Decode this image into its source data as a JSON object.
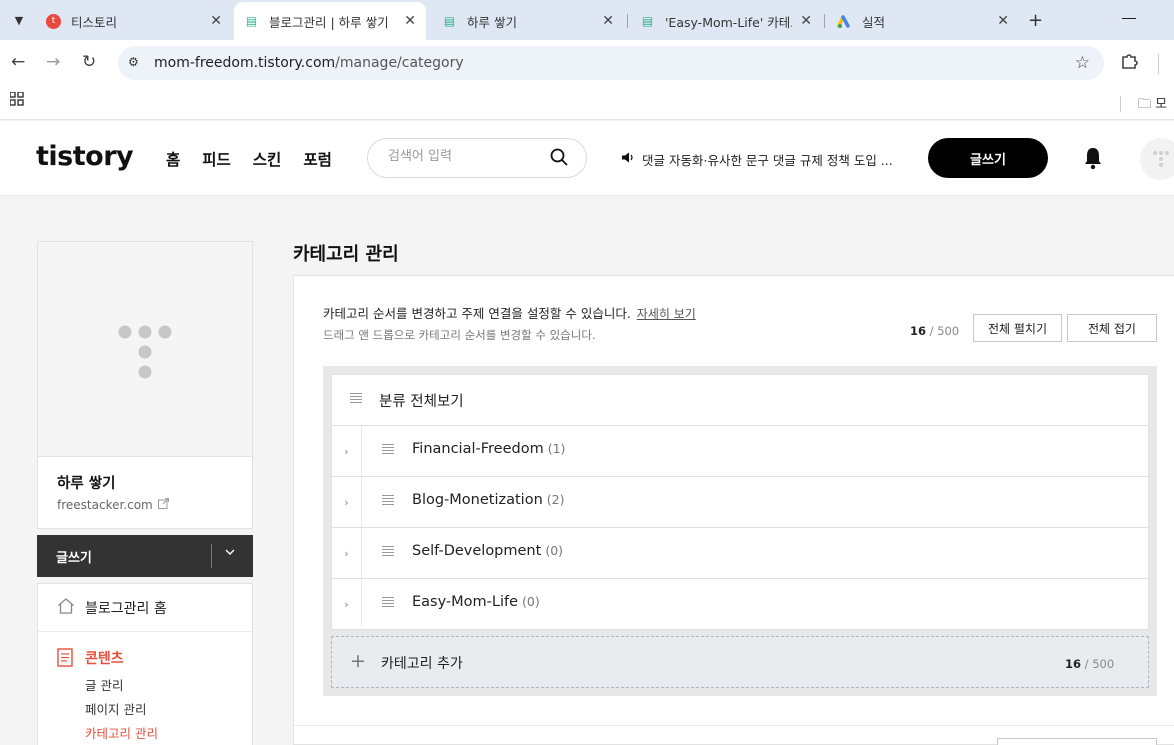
{
  "browser": {
    "tabs": [
      {
        "title": "티스토리",
        "favicon": "tistory-red-icon"
      },
      {
        "title": "블로그관리 | 하루 쌓기",
        "favicon": "blog-green-icon"
      },
      {
        "title": "하루 쌓기",
        "favicon": "blog-green-icon"
      },
      {
        "title": "'Easy-Mom-Life' 카테고",
        "favicon": "blog-green-icon"
      },
      {
        "title": "실적",
        "favicon": "google-ads-icon"
      }
    ],
    "close_glyph": "✕",
    "new_tab_glyph": "+",
    "url_host": "mom-freedom.tistory.com",
    "url_path": "/manage/category",
    "bookmark_folder": "모"
  },
  "header": {
    "logo": "tistory",
    "nav": [
      "홈",
      "피드",
      "스킨",
      "포럼"
    ],
    "search_placeholder": "검색어 입력",
    "notice": "댓글 자동화·유사한 문구 댓글 규제 정책 도입 ...",
    "write_button": "글쓰기"
  },
  "sidebar": {
    "blog_name": "하루 쌓기",
    "blog_url": "freestacker.com",
    "write_button": "글쓰기",
    "menu_home": "블로그관리 홈",
    "menu_content": "콘텐츠",
    "submenu": [
      "글 관리",
      "페이지 관리",
      "카테고리 관리"
    ]
  },
  "main": {
    "title": "카테고리 관리",
    "description": "카테고리 순서를 변경하고 주제 연결을 설정할 수 있습니다.",
    "more_link": "자세히 보기",
    "drag_hint": "드래그 앤 드롭으로 카테고리 순서를 변경할 수 있습니다.",
    "count_current": "16",
    "count_max": "/ 500",
    "expand_all": "전체 펼치기",
    "collapse_all": "전체 접기",
    "root_category": "분류 전체보기",
    "categories": [
      {
        "name": "Financial-Freedom",
        "count": "(1)"
      },
      {
        "name": "Blog-Monetization",
        "count": "(2)"
      },
      {
        "name": "Self-Development",
        "count": "(0)"
      },
      {
        "name": "Easy-Mom-Life",
        "count": "(0)"
      }
    ],
    "add_category": "카테고리 추가",
    "add_count_current": "16",
    "add_count_max": "/ 500"
  },
  "colors": {
    "accent": "#e5513c",
    "tab_bar": "#dfe7f5",
    "primary_button": "#000000"
  }
}
